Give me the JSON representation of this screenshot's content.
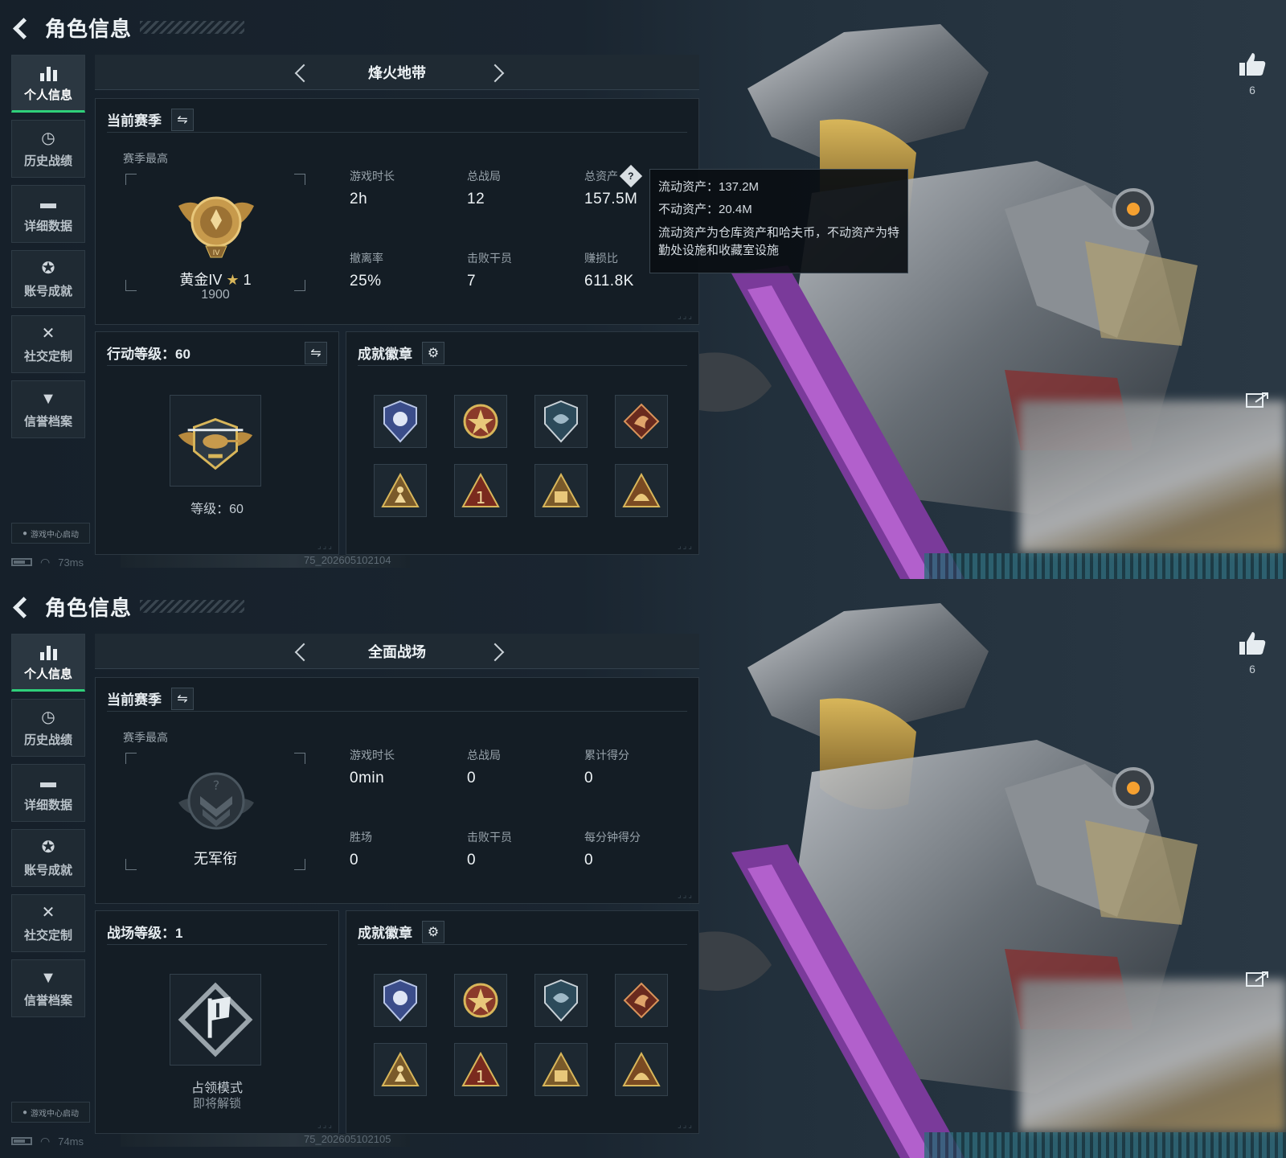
{
  "screens": [
    {
      "header": {
        "title": "角色信息"
      },
      "sidebar": {
        "items": [
          {
            "label": "个人信息",
            "icon": "bar-chart-icon",
            "active": true
          },
          {
            "label": "历史战绩",
            "icon": "clock-icon"
          },
          {
            "label": "详细数据",
            "icon": "folder-icon"
          },
          {
            "label": "账号成就",
            "icon": "medal-icon"
          },
          {
            "label": "社交定制",
            "icon": "tools-icon"
          },
          {
            "label": "信誉档案",
            "icon": "shield-icon"
          }
        ]
      },
      "game_center": "游戏中心启动",
      "status": {
        "ping": "73ms",
        "build": "75_202605102104"
      },
      "mode": "烽火地带",
      "season": {
        "title": "当前赛季",
        "best_label": "赛季最高",
        "rank_name": "黄金IV",
        "rank_stars": "1",
        "rank_score": "1900",
        "stats": [
          {
            "label": "游戏时长",
            "value": "2h"
          },
          {
            "label": "总战局",
            "value": "12"
          },
          {
            "label": "总资产",
            "value": "157.5M",
            "help": "?"
          },
          {
            "label": "撤离率",
            "value": "25%"
          },
          {
            "label": "击败干员",
            "value": "7"
          },
          {
            "label": "赚损比",
            "value": "611.8K"
          }
        ]
      },
      "tooltip": {
        "line1": "流动资产：137.2M",
        "line2": "不动资产：20.4M",
        "note": "流动资产为仓库资产和哈夫币，不动资产为特勤处设施和收藏室设施"
      },
      "level": {
        "title": "行动等级：60",
        "text": "等级：60",
        "sub": ""
      },
      "badges": {
        "title": "成就徽章"
      },
      "likes": "6"
    },
    {
      "header": {
        "title": "角色信息"
      },
      "sidebar": {
        "items": [
          {
            "label": "个人信息",
            "icon": "bar-chart-icon",
            "active": true
          },
          {
            "label": "历史战绩",
            "icon": "clock-icon"
          },
          {
            "label": "详细数据",
            "icon": "folder-icon"
          },
          {
            "label": "账号成就",
            "icon": "medal-icon"
          },
          {
            "label": "社交定制",
            "icon": "tools-icon"
          },
          {
            "label": "信誉档案",
            "icon": "shield-icon"
          }
        ]
      },
      "game_center": "游戏中心启动",
      "status": {
        "ping": "74ms",
        "build": "75_202605102105"
      },
      "mode": "全面战场",
      "season": {
        "title": "当前赛季",
        "best_label": "赛季最高",
        "rank_name": "无军衔",
        "rank_score": "",
        "stats": [
          {
            "label": "游戏时长",
            "value": "0min"
          },
          {
            "label": "总战局",
            "value": "0"
          },
          {
            "label": "累计得分",
            "value": "0"
          },
          {
            "label": "胜场",
            "value": "0"
          },
          {
            "label": "击败干员",
            "value": "0"
          },
          {
            "label": "每分钟得分",
            "value": "0"
          }
        ]
      },
      "level": {
        "title": "战场等级：1",
        "text": "占领模式",
        "sub": "即将解锁"
      },
      "badges": {
        "title": "成就徽章"
      },
      "likes": "6"
    }
  ],
  "colors": {
    "accent_green": "#2fd07a",
    "gold": "#d8b65a",
    "panel_bg": "#141d25"
  }
}
